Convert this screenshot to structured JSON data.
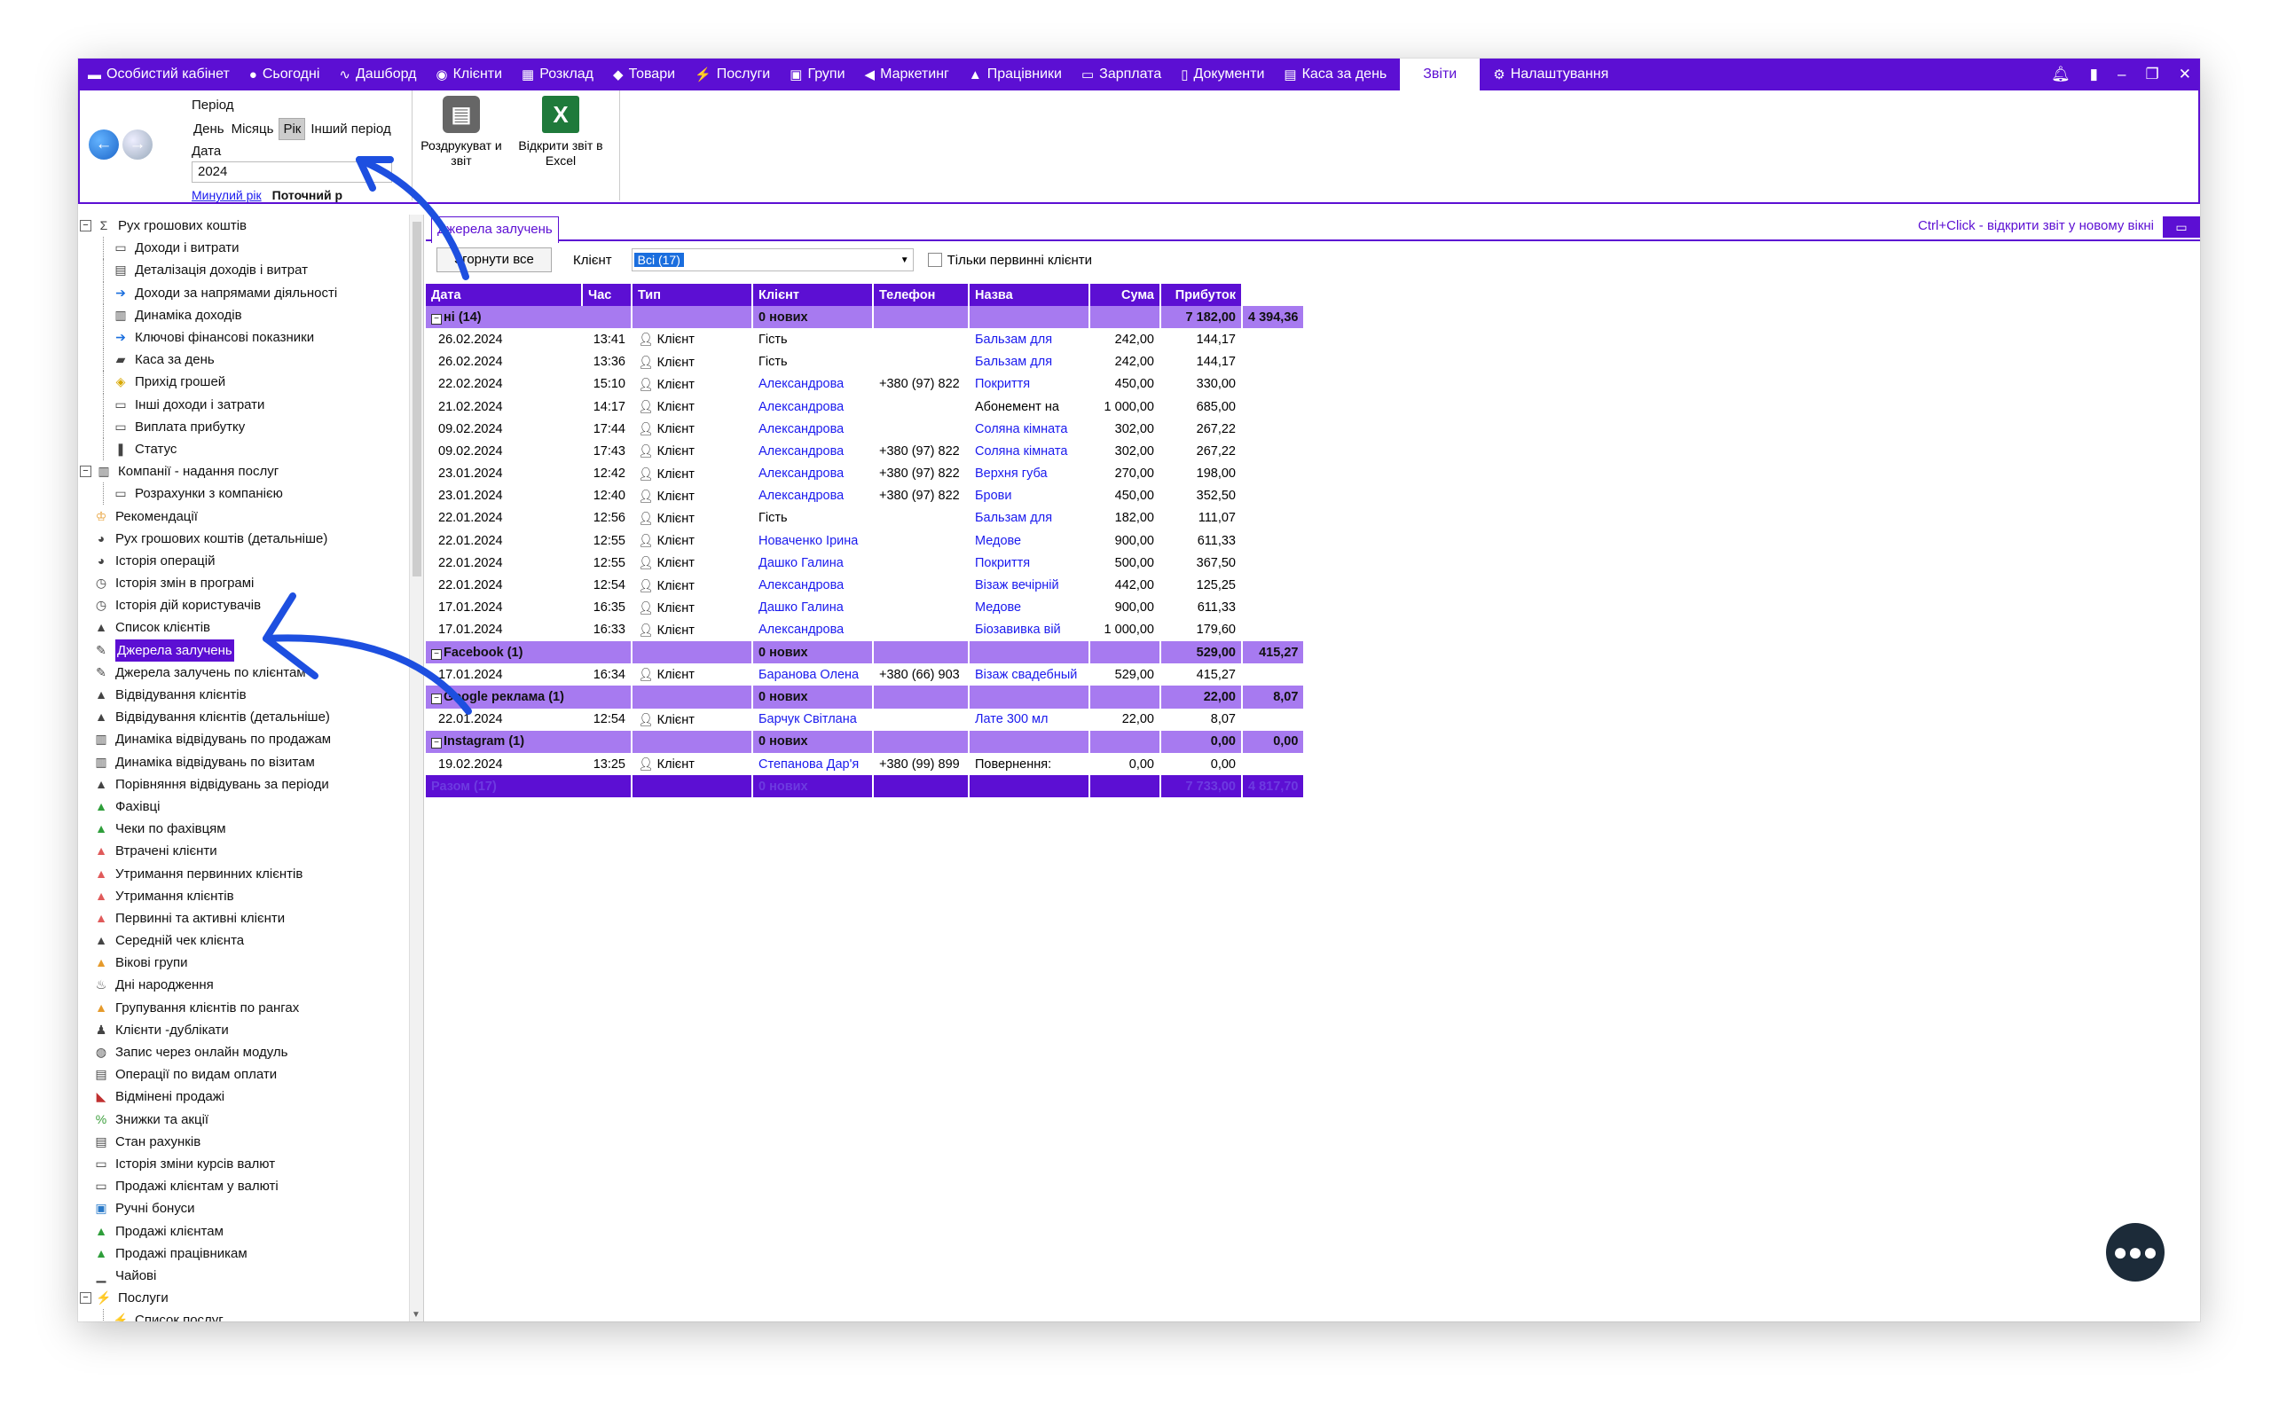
{
  "menubar": {
    "items": [
      {
        "label": "Особистий кабінет",
        "icon": "cabinet-icon",
        "glyph": "▬"
      },
      {
        "label": "Сьогодні",
        "icon": "clock-icon",
        "glyph": "●"
      },
      {
        "label": "Дашборд",
        "icon": "pulse-icon",
        "glyph": "∿"
      },
      {
        "label": "Клієнти",
        "icon": "user-circle-icon",
        "glyph": "◉"
      },
      {
        "label": "Розклад",
        "icon": "calendar-icon",
        "glyph": "▦"
      },
      {
        "label": "Товари",
        "icon": "box-icon",
        "glyph": "◆"
      },
      {
        "label": "Послуги",
        "icon": "lightning-icon",
        "glyph": "⚡"
      },
      {
        "label": "Групи",
        "icon": "group-icon",
        "glyph": "▣"
      },
      {
        "label": "Маркетинг",
        "icon": "megaphone-icon",
        "glyph": "◀"
      },
      {
        "label": "Працівники",
        "icon": "person-icon",
        "glyph": "▲"
      },
      {
        "label": "Зарплата",
        "icon": "money-icon",
        "glyph": "▭"
      },
      {
        "label": "Документи",
        "icon": "document-icon",
        "glyph": "▯"
      },
      {
        "label": "Каса за день",
        "icon": "calculator-icon",
        "glyph": "▤"
      },
      {
        "label": "Звіти",
        "icon": "",
        "glyph": ""
      },
      {
        "label": "Налаштування",
        "icon": "gear-icon",
        "glyph": "⚙"
      }
    ],
    "active_index": 13
  },
  "ribbon": {
    "period_label": "Період",
    "period_options": [
      "День",
      "Місяць",
      "Рік",
      "Інший період"
    ],
    "period_selected": "Рік",
    "date_label": "Дата",
    "date_value": "2024",
    "prev_year": "Минулий рік",
    "current_year": "Поточний р",
    "print_label": "Роздрукуват и звіт",
    "excel_label": "Відкрити звіт в Excel"
  },
  "tree": [
    {
      "level": 0,
      "expander": "minus",
      "label": "Рух грошових коштів",
      "icon": "sigma-icon",
      "glyph": "Σ"
    },
    {
      "level": 1,
      "label": "Доходи і витрати",
      "icon": "money-icon",
      "glyph": "▭"
    },
    {
      "level": 1,
      "label": "Деталізація доходів і витрат",
      "icon": "calculator-icon",
      "glyph": "▤"
    },
    {
      "level": 1,
      "label": "Доходи за напрямами діяльності",
      "icon": "arrow-right-icon",
      "glyph": "➔"
    },
    {
      "level": 1,
      "label": "Динаміка доходів",
      "icon": "chart-icon",
      "glyph": "▥"
    },
    {
      "level": 1,
      "label": "Ключові фінансові показники",
      "icon": "arrow-right-icon",
      "glyph": "➔"
    },
    {
      "level": 1,
      "label": "Каса за день",
      "icon": "cash-icon",
      "glyph": "▰"
    },
    {
      "level": 1,
      "label": "Прихід грошей",
      "icon": "coins-icon",
      "glyph": "◈"
    },
    {
      "level": 1,
      "label": "Інші доходи і затрати",
      "icon": "money-icon",
      "glyph": "▭"
    },
    {
      "level": 1,
      "label": "Виплата прибутку",
      "icon": "money-icon",
      "glyph": "▭"
    },
    {
      "level": 1,
      "label": "Статус",
      "icon": "status-icon",
      "glyph": "❚"
    },
    {
      "level": 0,
      "expander": "minus",
      "label": "Компанії - надання послуг",
      "icon": "building-icon",
      "glyph": "▥"
    },
    {
      "level": 1,
      "label": "Розрахунки з компанією",
      "icon": "money-icon",
      "glyph": "▭"
    },
    {
      "level": 0,
      "label": "Рекомендації",
      "icon": "trophy-icon",
      "glyph": "♔"
    },
    {
      "level": 0,
      "label": "Рух грошових коштів (детальніше)",
      "icon": "clock-icon",
      "glyph": "◕"
    },
    {
      "level": 0,
      "label": "Історія операцій",
      "icon": "clock-icon",
      "glyph": "◕"
    },
    {
      "level": 0,
      "label": "Історія змін в програмі",
      "icon": "history-icon",
      "glyph": "◷"
    },
    {
      "level": 0,
      "label": "Історія дій користувачів",
      "icon": "history-icon",
      "glyph": "◷"
    },
    {
      "level": 0,
      "label": "Список клієнтів",
      "icon": "person-icon",
      "glyph": "▲"
    },
    {
      "level": 0,
      "label": "Джерела залучень",
      "icon": "sources-icon",
      "glyph": "✎",
      "selected": true
    },
    {
      "level": 0,
      "label": "Джерела залучень по клієнтам",
      "icon": "sources-icon",
      "glyph": "✎"
    },
    {
      "level": 0,
      "label": "Відвідування клієнтів",
      "icon": "person-icon",
      "glyph": "▲"
    },
    {
      "level": 0,
      "label": "Відвідування клієнтів (детальніше)",
      "icon": "person-icon",
      "glyph": "▲"
    },
    {
      "level": 0,
      "label": "Динаміка відвідувань по продажам",
      "icon": "chart-icon",
      "glyph": "▥"
    },
    {
      "level": 0,
      "label": "Динаміка відвідувань по візитам",
      "icon": "chart-icon",
      "glyph": "▥"
    },
    {
      "level": 0,
      "label": "Порівняння відвідувань за періоди",
      "icon": "person-icon",
      "glyph": "▲"
    },
    {
      "level": 0,
      "label": "Фахівці",
      "icon": "person-green-icon",
      "glyph": "▲"
    },
    {
      "level": 0,
      "label": "Чеки по фахівцям",
      "icon": "person-green-icon",
      "glyph": "▲"
    },
    {
      "level": 0,
      "label": "Втрачені клієнти",
      "icon": "person-red-icon",
      "glyph": "▲"
    },
    {
      "level": 0,
      "label": "Утримання первинних клієнтів",
      "icon": "person-red-icon",
      "glyph": "▲"
    },
    {
      "level": 0,
      "label": "Утримання клієнтів",
      "icon": "person-red-icon",
      "glyph": "▲"
    },
    {
      "level": 0,
      "label": "Первинні та активні клієнти",
      "icon": "person-red-icon",
      "glyph": "▲"
    },
    {
      "level": 0,
      "label": "Середній чек клієнта",
      "icon": "person-icon",
      "glyph": "▲"
    },
    {
      "level": 0,
      "label": "Вікові групи",
      "icon": "person-orange-icon",
      "glyph": "▲"
    },
    {
      "level": 0,
      "label": "Дні народження",
      "icon": "cake-icon",
      "glyph": "♨"
    },
    {
      "level": 0,
      "label": "Групування клієнтів по рангах",
      "icon": "person-orange-icon",
      "glyph": "▲"
    },
    {
      "level": 0,
      "label": "Клієнти -дублікати",
      "icon": "users-icon",
      "glyph": "♟"
    },
    {
      "level": 0,
      "label": "Запис через онлайн модуль",
      "icon": "globe-icon",
      "glyph": "◍"
    },
    {
      "level": 0,
      "label": "Операції по видам оплати",
      "icon": "calculator-icon",
      "glyph": "▤"
    },
    {
      "level": 0,
      "label": "Відмінені продажі",
      "icon": "cancel-sale-icon",
      "glyph": "◣"
    },
    {
      "level": 0,
      "label": "Знижки та акції",
      "icon": "percent-icon",
      "glyph": "%"
    },
    {
      "level": 0,
      "label": "Стан рахунків",
      "icon": "calculator-icon",
      "glyph": "▤"
    },
    {
      "level": 0,
      "label": "Історія зміни курсів валют",
      "icon": "money-icon",
      "glyph": "▭"
    },
    {
      "level": 0,
      "label": "Продажі клієнтам у валюті",
      "icon": "money-icon",
      "glyph": "▭"
    },
    {
      "level": 0,
      "label": "Ручні бонуси",
      "icon": "bonus-icon",
      "glyph": "▣"
    },
    {
      "level": 0,
      "label": "Продажі клієнтам",
      "icon": "person-green-icon",
      "glyph": "▲"
    },
    {
      "level": 0,
      "label": "Продажі працівникам",
      "icon": "person-green-icon",
      "glyph": "▲"
    },
    {
      "level": 0,
      "label": "Чайові",
      "icon": "tips-icon",
      "glyph": "▁"
    },
    {
      "level": 0,
      "expander": "minus",
      "label": "Послуги",
      "icon": "lightning-icon",
      "glyph": "⚡"
    },
    {
      "level": 1,
      "label": "Список послуг",
      "icon": "lightning-icon",
      "glyph": "⚡"
    }
  ],
  "tab": {
    "label": "Джерела залучень"
  },
  "hint": {
    "text": "Ctrl+Click - відкрити звіт у новому вікні"
  },
  "filters": {
    "collapse_label": "Згорнути все",
    "client_label": "Клієнт",
    "client_value": "Всі (17)",
    "primary_only_label": "Тільки первинні клієнти"
  },
  "table": {
    "columns": [
      "Дата",
      "Час",
      "Тип",
      "Клієнт",
      "Телефон",
      "Назва",
      "Сума",
      "Прибуток"
    ],
    "groups": [
      {
        "name": "ні (14)",
        "new_label": "0 нових",
        "sum": "7 182,00",
        "profit": "4 394,36",
        "rows": [
          {
            "date": "26.02.2024",
            "time": "13:41",
            "type": "Клієнт",
            "client": "Гість",
            "client_link": false,
            "phone": "",
            "name": "Бальзам для",
            "sum": "242,00",
            "profit": "144,17"
          },
          {
            "date": "26.02.2024",
            "time": "13:36",
            "type": "Клієнт",
            "client": "Гість",
            "client_link": false,
            "phone": "",
            "name": "Бальзам для",
            "sum": "242,00",
            "profit": "144,17"
          },
          {
            "date": "22.02.2024",
            "time": "15:10",
            "type": "Клієнт",
            "client": "Александрова",
            "client_link": true,
            "phone": "+380 (97) 822",
            "name": "Покриття",
            "sum": "450,00",
            "profit": "330,00"
          },
          {
            "date": "21.02.2024",
            "time": "14:17",
            "type": "Клієнт",
            "client": "Александрова",
            "client_link": true,
            "phone": "",
            "name": "Абонемент на",
            "sum": "1 000,00",
            "profit": "685,00",
            "name_plain": true
          },
          {
            "date": "09.02.2024",
            "time": "17:44",
            "type": "Клієнт",
            "client": "Александрова",
            "client_link": true,
            "phone": "",
            "name": "Соляна кімната",
            "sum": "302,00",
            "profit": "267,22"
          },
          {
            "date": "09.02.2024",
            "time": "17:43",
            "type": "Клієнт",
            "client": "Александрова",
            "client_link": true,
            "phone": "+380 (97) 822",
            "name": "Соляна кімната",
            "sum": "302,00",
            "profit": "267,22"
          },
          {
            "date": "23.01.2024",
            "time": "12:42",
            "type": "Клієнт",
            "client": "Александрова",
            "client_link": true,
            "phone": "+380 (97) 822",
            "name": "Верхня губа",
            "sum": "270,00",
            "profit": "198,00"
          },
          {
            "date": "23.01.2024",
            "time": "12:40",
            "type": "Клієнт",
            "client": "Александрова",
            "client_link": true,
            "phone": "+380 (97) 822",
            "name": "Брови",
            "sum": "450,00",
            "profit": "352,50"
          },
          {
            "date": "22.01.2024",
            "time": "12:56",
            "type": "Клієнт",
            "client": "Гість",
            "client_link": false,
            "phone": "",
            "name": "Бальзам для",
            "sum": "182,00",
            "profit": "111,07"
          },
          {
            "date": "22.01.2024",
            "time": "12:55",
            "type": "Клієнт",
            "client": "Новаченко Ірина",
            "client_link": true,
            "phone": "",
            "name": "Медове",
            "sum": "900,00",
            "profit": "611,33"
          },
          {
            "date": "22.01.2024",
            "time": "12:55",
            "type": "Клієнт",
            "client": "Дашко Галина",
            "client_link": true,
            "phone": "",
            "name": "Покриття",
            "sum": "500,00",
            "profit": "367,50"
          },
          {
            "date": "22.01.2024",
            "time": "12:54",
            "type": "Клієнт",
            "client": "Александрова",
            "client_link": true,
            "phone": "",
            "name": "Візаж вечірній",
            "sum": "442,00",
            "profit": "125,25"
          },
          {
            "date": "17.01.2024",
            "time": "16:35",
            "type": "Клієнт",
            "client": "Дашко Галина",
            "client_link": true,
            "phone": "",
            "name": "Медове",
            "sum": "900,00",
            "profit": "611,33"
          },
          {
            "date": "17.01.2024",
            "time": "16:33",
            "type": "Клієнт",
            "client": "Александрова",
            "client_link": true,
            "phone": "",
            "name": "Біозавивка вій",
            "sum": "1 000,00",
            "profit": "179,60"
          }
        ]
      },
      {
        "name": "Facebook (1)",
        "new_label": "0 нових",
        "sum": "529,00",
        "profit": "415,27",
        "rows": [
          {
            "date": "17.01.2024",
            "time": "16:34",
            "type": "Клієнт",
            "client": "Баранова Олена",
            "client_link": true,
            "phone": "+380 (66) 903",
            "name": "Візаж свадебный",
            "sum": "529,00",
            "profit": "415,27"
          }
        ]
      },
      {
        "name": "Google реклама (1)",
        "new_label": "0 нових",
        "sum": "22,00",
        "profit": "8,07",
        "rows": [
          {
            "date": "22.01.2024",
            "time": "12:54",
            "type": "Клієнт",
            "client": "Барчук Світлана",
            "client_link": true,
            "phone": "",
            "name": "Лате 300 мл",
            "sum": "22,00",
            "profit": "8,07"
          }
        ]
      },
      {
        "name": "Instagram (1)",
        "new_label": "0 нових",
        "sum": "0,00",
        "profit": "0,00",
        "rows": [
          {
            "date": "19.02.2024",
            "time": "13:25",
            "type": "Клієнт",
            "client": "Степанова Дар'я",
            "client_link": true,
            "phone": "+380 (99) 899",
            "name": "Повернення:",
            "sum": "0,00",
            "profit": "0,00",
            "name_plain": true
          }
        ]
      }
    ],
    "total": {
      "label": "Разом (17)",
      "new_label": "0 нових",
      "sum": "7 733,00",
      "profit": "4 817,70"
    }
  },
  "colors": {
    "accent": "#5c0fd3",
    "group_row": "#a77af0",
    "link": "#1a1aee",
    "annotation_arrow": "#1d4fe0"
  }
}
